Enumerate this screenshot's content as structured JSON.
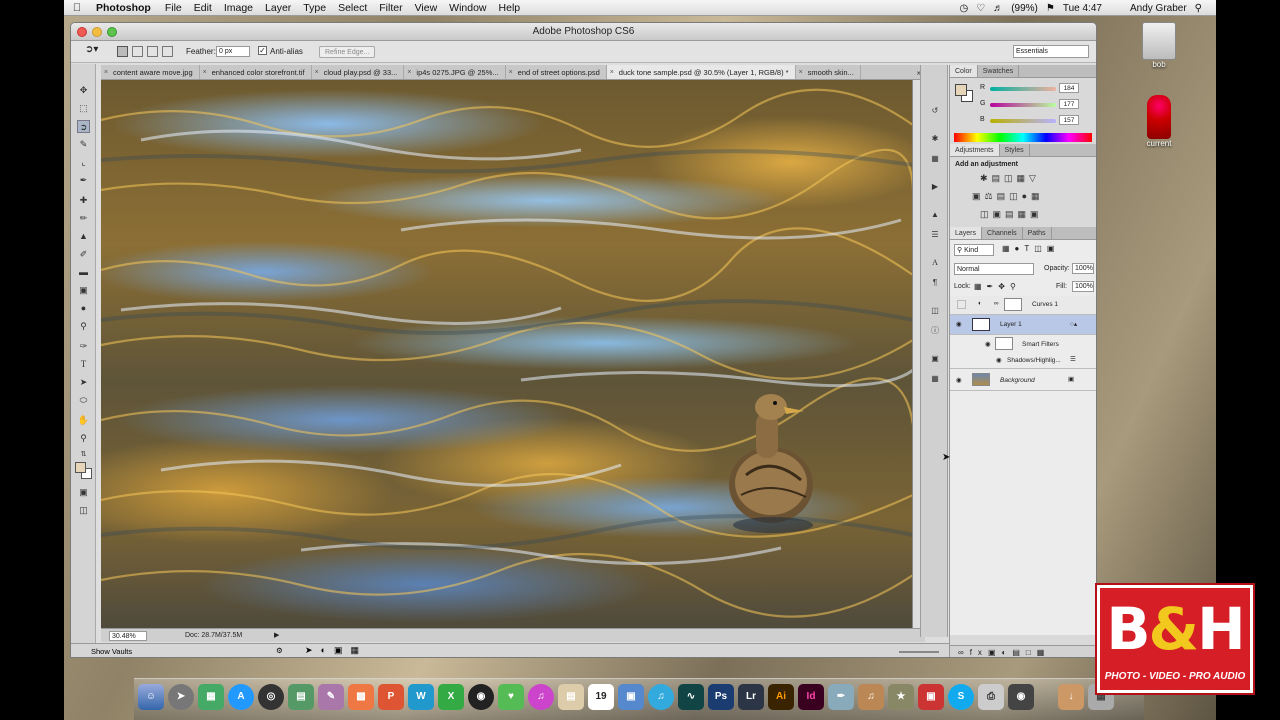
{
  "menubar": {
    "app_name": "Photoshop",
    "items": [
      "File",
      "Edit",
      "Image",
      "Layer",
      "Type",
      "Select",
      "Filter",
      "View",
      "Window",
      "Help"
    ],
    "battery": "(99%)",
    "time": "Tue 4:47",
    "user": "Andy Graber"
  },
  "window": {
    "title": "Adobe Photoshop CS6",
    "workspace": "Essentials"
  },
  "options": {
    "feather_label": "Feather:",
    "feather_value": "0 px",
    "antialias_label": "Anti-alias",
    "refine_label": "Refine Edge..."
  },
  "tabs": [
    "content aware move.jpg",
    "enhanced color storefront.tif",
    "cloud play.psd @ 33...",
    "ip4s 0275.JPG @ 25%...",
    "end of street options.psd",
    "duck tone sample.psd @ 30.5% (Layer 1, RGB/8) *",
    "smooth skin..."
  ],
  "status": {
    "zoom": "30.48%",
    "doc": "Doc: 28.7M/37.5M",
    "show_vaults": "Show Vaults"
  },
  "color_panel": {
    "tabs": [
      "Color",
      "Swatches"
    ],
    "r_label": "R",
    "r_value": "184",
    "g_label": "G",
    "g_value": "177",
    "b_label": "B",
    "b_value": "157"
  },
  "adjustments_panel": {
    "tabs": [
      "Adjustments",
      "Styles"
    ],
    "heading": "Add an adjustment"
  },
  "layers_panel": {
    "tabs": [
      "Layers",
      "Channels",
      "Paths"
    ],
    "kind": "Kind",
    "blend_mode": "Normal",
    "opacity_label": "Opacity:",
    "opacity_value": "100%",
    "lock_label": "Lock:",
    "fill_label": "Fill:",
    "fill_value": "100%",
    "layers": [
      "Curves 1",
      "Layer 1",
      "Smart Filters",
      "Shadows/Highlig...",
      "Background"
    ]
  },
  "desktop": {
    "icon1": "bob",
    "icon2": "current"
  },
  "watermark": {
    "logo_text_b": "B",
    "logo_text_amp": "&",
    "logo_text_h": "H",
    "tagline": "PHOTO - VIDEO - PRO AUDIO"
  },
  "dock": {
    "apps": [
      "Ps",
      "Lr",
      "Ai",
      "Id"
    ],
    "calendar_day": "19"
  },
  "colors": {
    "accent_red": "#d51e26",
    "ps_blue": "#1b3c70",
    "selected_layer": "#b9c8e6"
  }
}
